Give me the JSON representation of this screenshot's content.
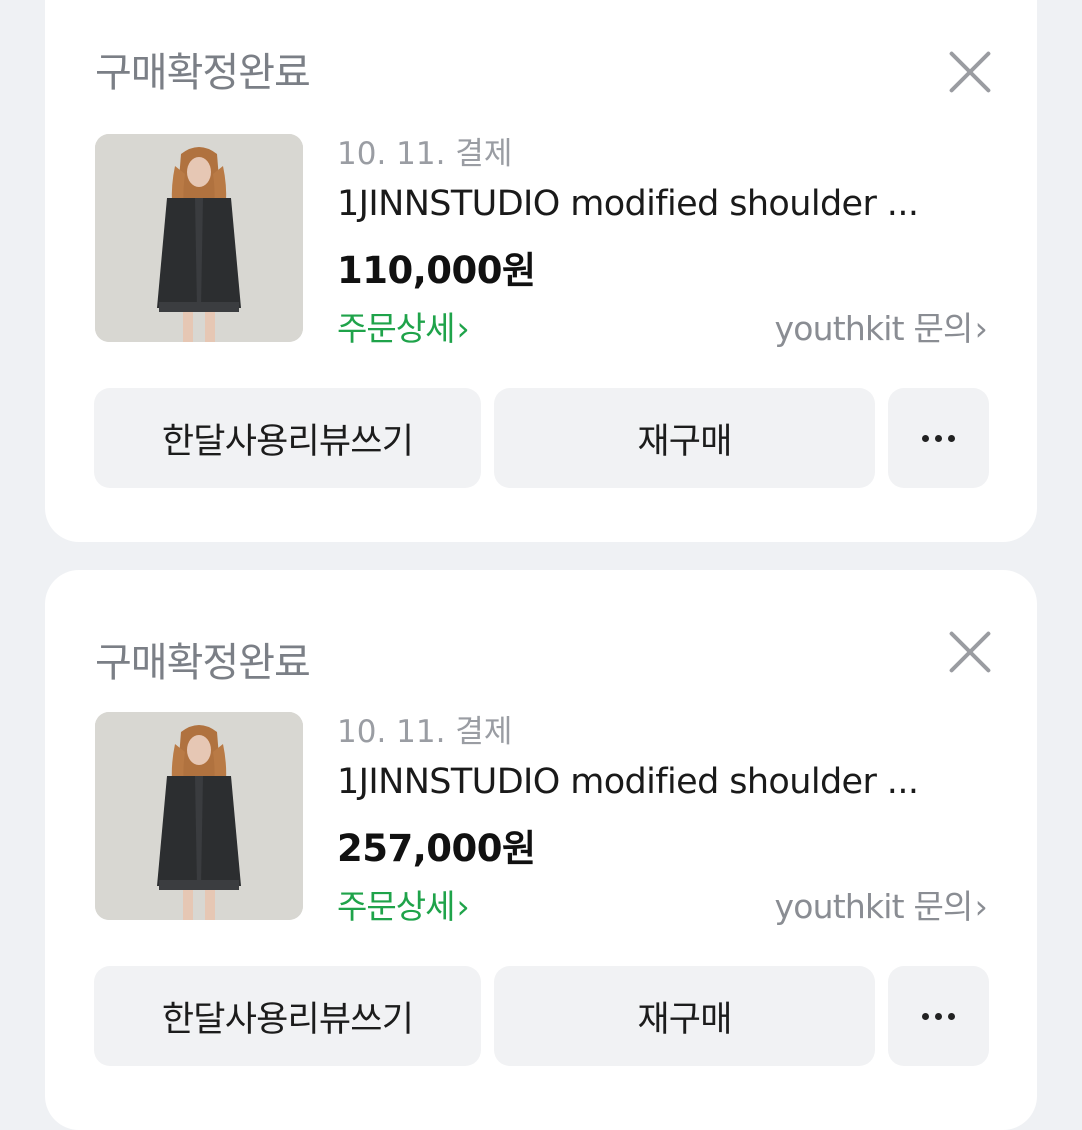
{
  "orders": [
    {
      "status": "구매확정완료",
      "date": "10. 11. 결제",
      "title": "1JINNSTUDIO modified shoulder ...",
      "price": "110,000원",
      "detail_link": "주문상세",
      "seller_link": "youthkit 문의",
      "buttons": {
        "review": "한달사용리뷰쓰기",
        "rebuy": "재구매"
      }
    },
    {
      "status": "구매확정완료",
      "date": "10. 11. 결제",
      "title": "1JINNSTUDIO modified shoulder ...",
      "price": "257,000원",
      "detail_link": "주문상세",
      "seller_link": "youthkit 문의",
      "buttons": {
        "review": "한달사용리뷰쓰기",
        "rebuy": "재구매"
      }
    }
  ],
  "chevron": "›",
  "icons": {
    "close": "close-icon",
    "more": "more-horizontal-icon",
    "chevron": "chevron-right-icon"
  },
  "colors": {
    "accent_green": "#1fa34a",
    "background": "#eff1f4",
    "card": "#ffffff",
    "button": "#f1f2f4"
  }
}
